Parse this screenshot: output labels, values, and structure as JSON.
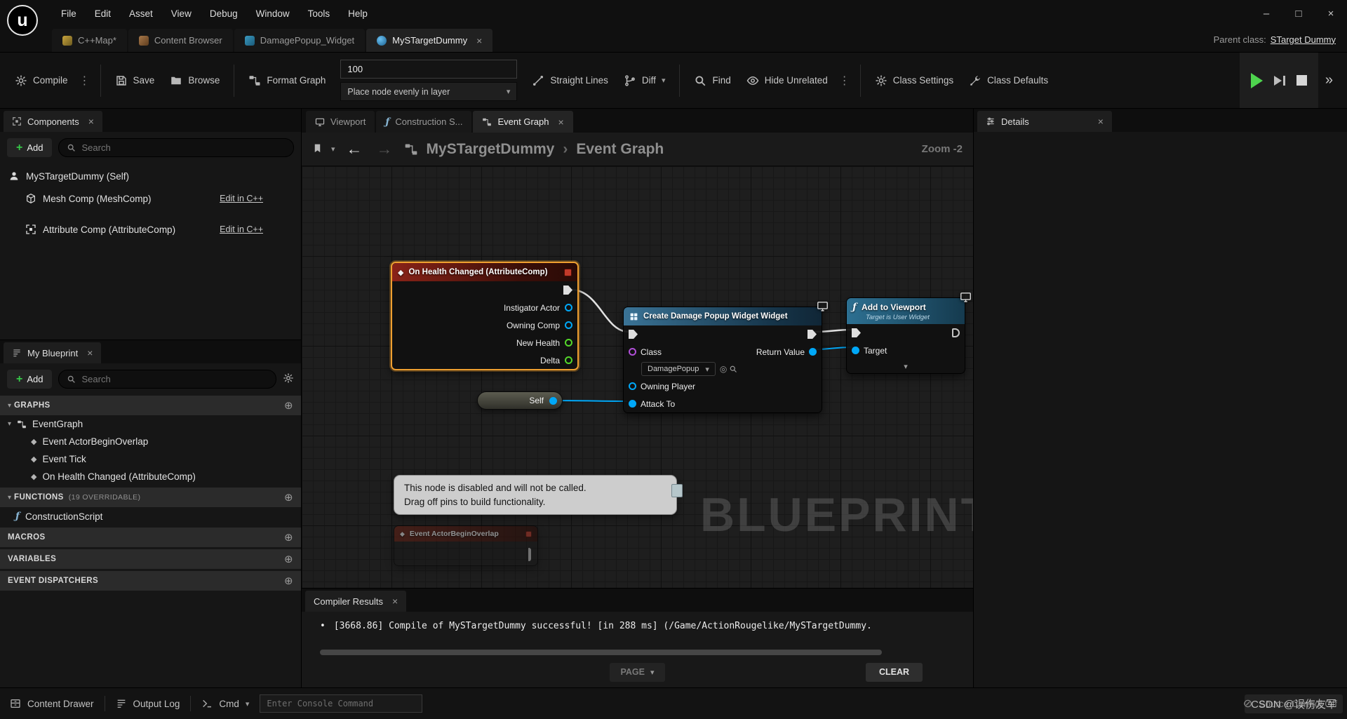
{
  "colors": {
    "selection_orange": "#f0a030",
    "pin_object_blue": "#00a8f8",
    "pin_float_green": "#55d82a",
    "pin_class_purple": "#b04fd8",
    "exec_pin_white": "#dedede",
    "event_header_red": "#8a2318",
    "function_header_blue": "#3a7396",
    "play_green": "#4ed44e"
  },
  "icons": {
    "close": "×",
    "minimize": "–",
    "maximize": "□",
    "kebab": "⋮",
    "chevron_down": "▾",
    "breadcrumb_sep": "›",
    "double_chevron": "»",
    "circle_plus": "⊕",
    "plus": "+",
    "diamond": "◆",
    "event_glyph": "◆",
    "fn": "ƒ",
    "bullet": "•",
    "source_control": "⊘",
    "back_arrow": "←",
    "forward_arrow": "→",
    "ue_logo": "u",
    "target_glyph": "◎",
    "twisty_open": "▾"
  },
  "menubar": {
    "items": [
      "File",
      "Edit",
      "Asset",
      "View",
      "Debug",
      "Window",
      "Tools",
      "Help"
    ]
  },
  "tabbar": {
    "tabs": [
      {
        "label": "C++Map*"
      },
      {
        "label": "Content Browser"
      },
      {
        "label": "DamagePopup_Widget"
      },
      {
        "label": "MySTargetDummy"
      }
    ],
    "parent_class_label": "Parent class:",
    "parent_class_value": "STarget Dummy"
  },
  "toolbar": {
    "compile_label": "Compile",
    "save_label": "Save",
    "browse_label": "Browse",
    "format_graph_label": "Format Graph",
    "node_spacing_value": "100",
    "place_node_label": "Place node evenly in layer",
    "straight_lines_label": "Straight Lines",
    "diff_label": "Diff",
    "find_label": "Find",
    "hide_unrelated_label": "Hide Unrelated",
    "class_settings_label": "Class Settings",
    "class_defaults_label": "Class Defaults"
  },
  "components": {
    "tab_title": "Components",
    "add_label": "Add",
    "search_placeholder": "Search",
    "items": [
      {
        "label": "MySTargetDummy (Self)"
      },
      {
        "label": "Mesh Comp (MeshComp)",
        "link": "Edit in C++"
      },
      {
        "label": "Attribute Comp (AttributeComp)",
        "link": "Edit in C++"
      }
    ]
  },
  "myblueprint": {
    "tab_title": "My Blueprint",
    "add_label": "Add",
    "search_placeholder": "Search",
    "sections": {
      "graphs": "GRAPHS",
      "functions": "FUNCTIONS",
      "functions_suffix": "(19 OVERRIDABLE)",
      "macros": "MACROS",
      "variables": "VARIABLES",
      "event_dispatchers": "EVENT DISPATCHERS"
    },
    "graph_items": {
      "event_graph": "EventGraph",
      "children": [
        "Event ActorBeginOverlap",
        "Event Tick",
        "On Health Changed (AttributeComp)"
      ]
    },
    "function_items": [
      "ConstructionScript"
    ]
  },
  "graph": {
    "tabs": [
      {
        "label": "Viewport"
      },
      {
        "label": "Construction S..."
      },
      {
        "label": "Event Graph"
      }
    ],
    "breadcrumb_root": "MySTargetDummy",
    "breadcrumb_current": "Event Graph",
    "zoom_label": "Zoom -2",
    "watermark": "BLUEPRINT",
    "nodes": {
      "on_health": {
        "title": "On Health Changed (AttributeComp)",
        "pins": [
          "Instigator Actor",
          "Owning Comp",
          "New Health",
          "Delta"
        ]
      },
      "create_widget": {
        "title": "Create Damage Popup Widget Widget",
        "class_label": "Class",
        "class_value": "DamagePopup",
        "return_label": "Return Value",
        "owning_player_label": "Owning Player",
        "attach_label": "Attack To"
      },
      "add_to_viewport": {
        "title": "Add to Viewport",
        "subtitle": "Target is User Widget",
        "target_label": "Target"
      },
      "self_node": {
        "label": "Self"
      },
      "disabled_event": {
        "title": "Event ActorBeginOverlap"
      },
      "disabled_note": {
        "line1": "This node is disabled and will not be called.",
        "line2": "Drag off pins to build functionality."
      }
    }
  },
  "compiler": {
    "tab_title": "Compiler Results",
    "log": "[3668.86] Compile of MySTargetDummy successful! [in 288 ms] (/Game/ActionRougelike/MySTargetDummy.",
    "page_label": "PAGE",
    "clear_label": "CLEAR"
  },
  "details": {
    "tab_title": "Details"
  },
  "statusbar": {
    "content_drawer": "Content Drawer",
    "output_log": "Output Log",
    "cmd": "Cmd",
    "console_placeholder": "Enter Console Command",
    "source_control": "Source Control Off",
    "watermark": "CSDN @误伤友军"
  }
}
